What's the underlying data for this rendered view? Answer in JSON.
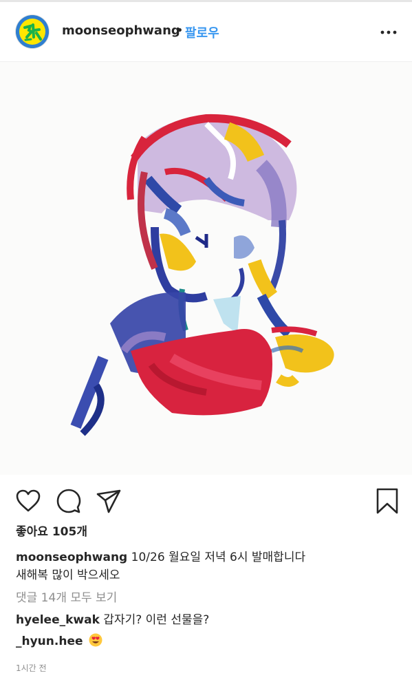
{
  "header": {
    "username": "moonseophwang",
    "separator": "•",
    "follow_label": "팔로우",
    "avatar_icon": "profile-avatar-logo",
    "more_icon": "more-horizontal-icon"
  },
  "post": {
    "image_icon": "painted-portrait-artwork",
    "actions": {
      "like_icon": "heart-icon",
      "comment_icon": "comment-bubble-icon",
      "share_icon": "send-icon",
      "save_icon": "bookmark-icon"
    },
    "likes_label": "좋아요 105개",
    "caption": {
      "username": "moonseophwang",
      "text": "10/26 월요일 저녁 6시 발매합니다",
      "text_line2": "새해복 많이 박으세오"
    },
    "view_comments": "댓글 14개 모두 보기",
    "comments": [
      {
        "username": "hyelee_kwak",
        "text": "갑자기? 이런 선물을?"
      },
      {
        "username": "_hyun.hee",
        "text": "",
        "emoji_icon": "heart-eyes-emoji-icon"
      }
    ],
    "timestamp": "1시간 전"
  },
  "colors": {
    "link_blue": "#3897f0",
    "muted_gray": "#8e8e8e",
    "text": "#262626"
  }
}
